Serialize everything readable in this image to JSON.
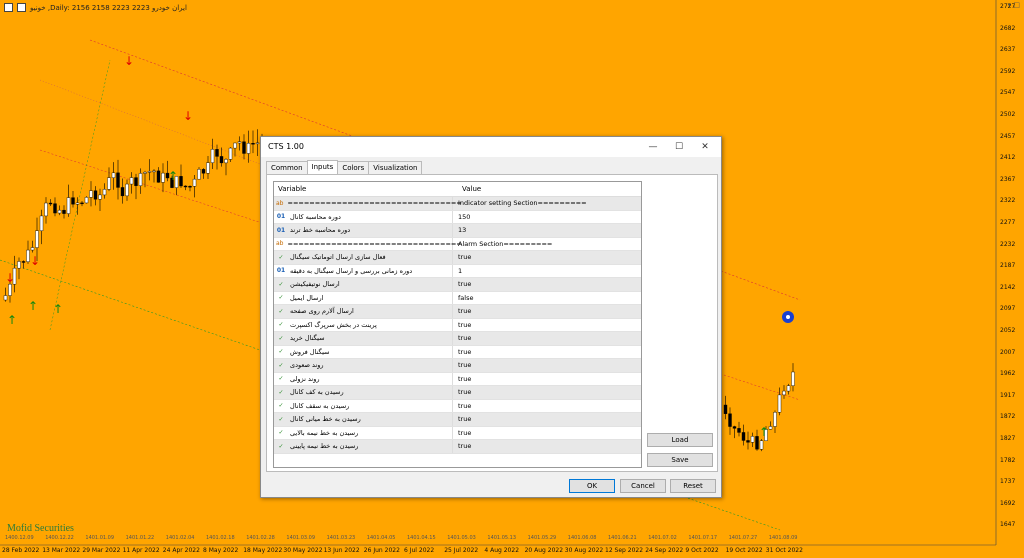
{
  "chart": {
    "symbol_line": "خونیو ,Daily: 2156 2158 2223 2223 ایران خودرو",
    "watermark": "Mofid Securities",
    "price_ticks": [
      "2727",
      "2682",
      "2637",
      "2592",
      "2547",
      "2502",
      "2457",
      "2412",
      "2367",
      "2322",
      "2277",
      "2232",
      "2187",
      "2142",
      "2097",
      "2052",
      "2007",
      "1962",
      "1917",
      "1872",
      "1827",
      "1782",
      "1737",
      "1692",
      "1647"
    ],
    "date_ticks": [
      "28 Feb 2022",
      "13 Mar 2022",
      "29 Mar 2022",
      "11 Apr 2022",
      "24 Apr 2022",
      "8 May 2022",
      "18 May 2022",
      "30 May 2022",
      "13 Jun 2022",
      "26 Jun 2022",
      "6 Jul 2022",
      "25 Jul 2022",
      "4 Aug 2022",
      "20 Aug 2022",
      "30 Aug 2022",
      "12 Sep 2022",
      "24 Sep 2022",
      "9 Oct 2022",
      "19 Oct 2022",
      "31 Oct 2022"
    ],
    "persian_date_ticks": [
      "1400.12.09",
      "1400.12.22",
      "1401.01.09",
      "1401.01.22",
      "1401.02.04",
      "1401.02.18",
      "1401.02.28",
      "1401.03.09",
      "1401.03.23",
      "1401.04.05",
      "1401.04.15",
      "1401.05.03",
      "1401.05.13",
      "1401.05.29",
      "1401.06.08",
      "1401.06.21",
      "1401.07.02",
      "1401.07.17",
      "1401.07.27",
      "1401.08.09"
    ]
  },
  "dialog": {
    "title": "CTS 1.00",
    "tabs": [
      "Common",
      "Inputs",
      "Colors",
      "Visualization"
    ],
    "active_tab": "Inputs",
    "columns": {
      "variable": "Variable",
      "value": "Value"
    },
    "rows": [
      {
        "icon": "ab",
        "variable": "================================",
        "value": "Indicator setting Section========="
      },
      {
        "icon": "01",
        "variable": "دوره محاسبه کانال",
        "value": "150"
      },
      {
        "icon": "01",
        "variable": "دوره محاسبه خط ترند",
        "value": "13"
      },
      {
        "icon": "ab",
        "variable": "================================",
        "value": "Alarm Section========="
      },
      {
        "icon": "chk",
        "variable": "فعال سازی ارسال اتوماتیک سیگنال",
        "value": "true"
      },
      {
        "icon": "01",
        "variable": "دوره زمانی بررسی و ارسال سیگنال به دقیقه",
        "value": "1"
      },
      {
        "icon": "chk",
        "variable": "ارسال نوتیفیکیشن",
        "value": "true"
      },
      {
        "icon": "chk",
        "variable": "ارسال ایمیل",
        "value": "false"
      },
      {
        "icon": "chk",
        "variable": "ارسال آلارم روی صفحه",
        "value": "true"
      },
      {
        "icon": "chk",
        "variable": "پرینت در بخش سرپرگ اکسپرت",
        "value": "true"
      },
      {
        "icon": "chk",
        "variable": "سیگنال خرید",
        "value": "true"
      },
      {
        "icon": "chk",
        "variable": "سیگنال فروش",
        "value": "true"
      },
      {
        "icon": "chk",
        "variable": "روند صعودی",
        "value": "true"
      },
      {
        "icon": "chk",
        "variable": "روند نزولی",
        "value": "true"
      },
      {
        "icon": "chk",
        "variable": "رسیدن به کف کانال",
        "value": "true"
      },
      {
        "icon": "chk",
        "variable": "رسیدن به سقف کانال",
        "value": "true"
      },
      {
        "icon": "chk",
        "variable": "رسیدن به خط میانی کانال",
        "value": "true"
      },
      {
        "icon": "chk",
        "variable": "رسیدن به خط نیمه بالایی",
        "value": "true"
      },
      {
        "icon": "chk",
        "variable": "رسیدن به خط نیمه پایینی",
        "value": "true"
      }
    ],
    "buttons": {
      "load": "Load",
      "save": "Save",
      "ok": "OK",
      "cancel": "Cancel",
      "reset": "Reset"
    },
    "window_controls": {
      "minimize": "—",
      "maximize": "☐",
      "close": "✕"
    }
  }
}
